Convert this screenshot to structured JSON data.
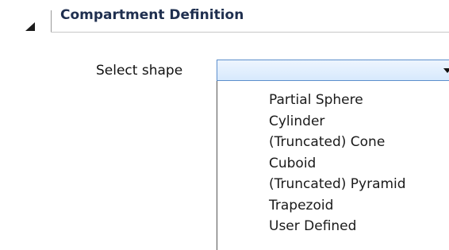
{
  "section": {
    "title": "Compartment Definition",
    "toggle_icon": "collapse-triangle-icon"
  },
  "shape_field": {
    "label": "Select shape",
    "value": "",
    "dropdown_icon": "chevron-down-icon",
    "options": [
      "Partial Sphere",
      "Cylinder",
      "(Truncated) Cone",
      "Cuboid",
      "(Truncated) Pyramid",
      "Trapezoid",
      "User Defined"
    ]
  },
  "colors": {
    "title": "#1f2f4f",
    "select_border": "#5d8fcc",
    "select_fill": "#d7e9fd"
  }
}
